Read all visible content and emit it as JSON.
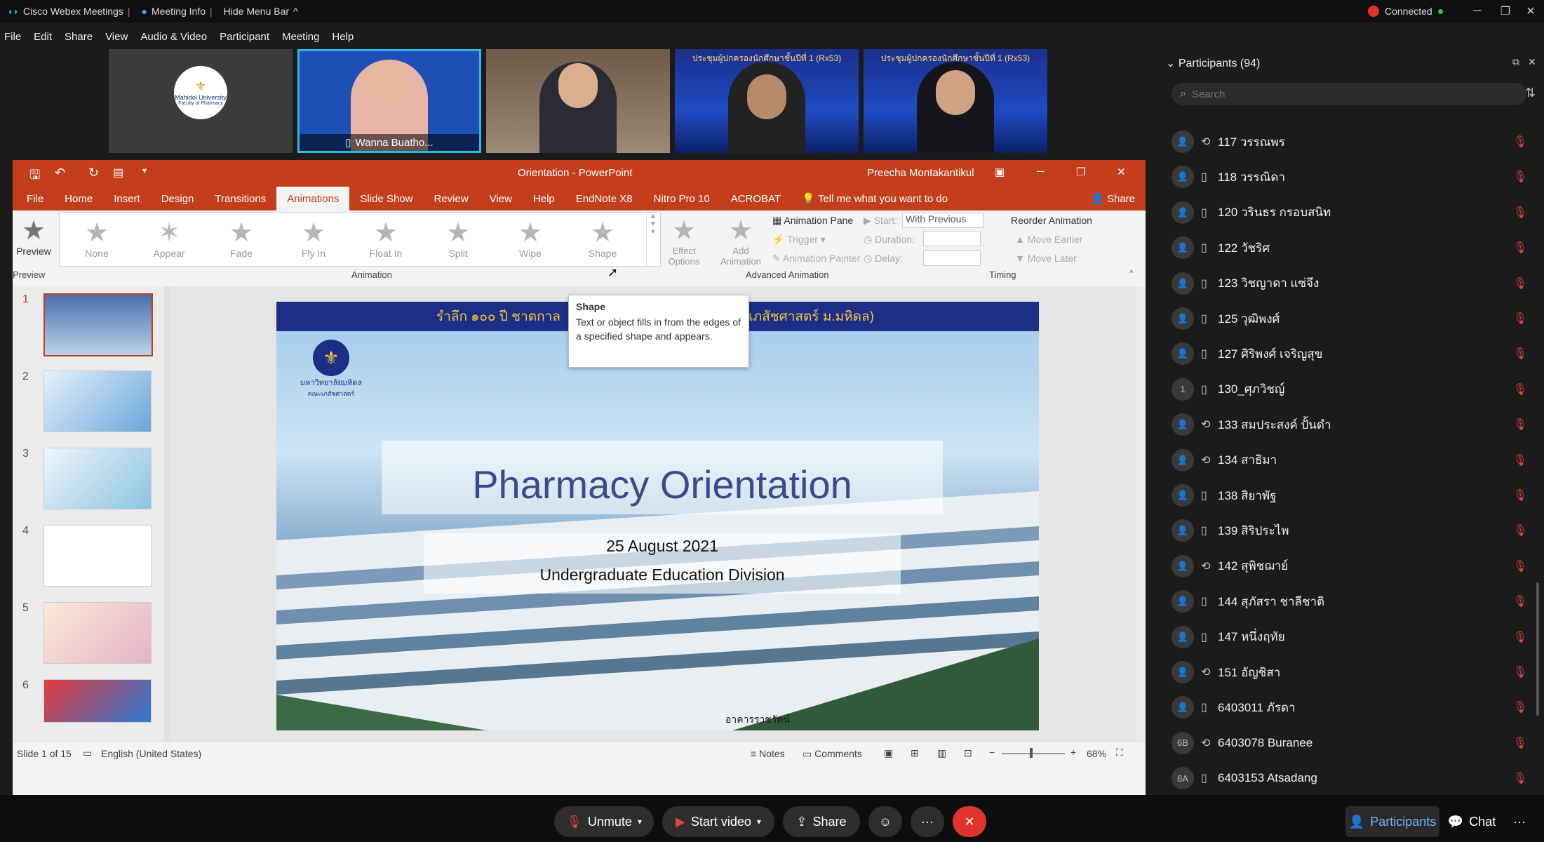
{
  "webex": {
    "app_title": "Cisco Webex Meetings",
    "meeting_info": "Meeting Info",
    "hide_menu": "Hide Menu Bar",
    "connected": "Connected",
    "menu": [
      "File",
      "Edit",
      "Share",
      "View",
      "Audio & Video",
      "Participant",
      "Meeting",
      "Help"
    ]
  },
  "videos": [
    {
      "kind": "logo",
      "logo_text": "Mahidol University",
      "logo_sub": "Faculty of Pharmacy"
    },
    {
      "kind": "person",
      "name": "Wanna Buatho..."
    },
    {
      "kind": "person"
    },
    {
      "kind": "person",
      "banner": "ประชุมผู้ปกครองนักศึกษาชั้นปีที่ 1 (Rx53)"
    },
    {
      "kind": "person",
      "banner": "ประชุมผู้ปกครองนักศึกษาชั้นปีที่ 1 (Rx53)"
    }
  ],
  "ppt": {
    "title": "Orientation  -  PowerPoint",
    "user": "Preecha Montakantikul",
    "tabs": [
      "File",
      "Home",
      "Insert",
      "Design",
      "Transitions",
      "Animations",
      "Slide Show",
      "Review",
      "View",
      "Help",
      "EndNote X8",
      "Nitro Pro 10",
      "ACROBAT"
    ],
    "active_tab": "Animations",
    "tell_me": "Tell me what you want to do",
    "share": "Share",
    "preview": "Preview",
    "preview_group": "Preview",
    "animations": [
      "None",
      "Appear",
      "Fade",
      "Fly In",
      "Float In",
      "Split",
      "Wipe",
      "Shape"
    ],
    "animation_group": "Animation",
    "effect_options": "Effect Options",
    "add_animation": "Add Animation",
    "animation_pane": "Animation Pane",
    "trigger": "Trigger",
    "animation_painter": "Animation Painter",
    "advanced_group": "Advanced Animation",
    "start_label": "Start:",
    "start_value": "With Previous",
    "duration_label": "Duration:",
    "delay_label": "Delay:",
    "reorder": "Reorder Animation",
    "move_earlier": "Move Earlier",
    "move_later": "Move Later",
    "timing_group": "Timing",
    "tooltip_title": "Shape",
    "tooltip_body": "Text or object fills in from the edges of a specified shape and appears.",
    "thumbs": [
      "1",
      "2",
      "3",
      "4",
      "5",
      "6"
    ],
    "slide": {
      "banner": "รำลึก ๑๐๐ ปี ชาตกาล",
      "banner_right": "ะเภสัชศาสตร์ ม.มหิดล)",
      "logo_caption": "มหาวิทยาลัยมหิดล",
      "logo_sub": "คณะเภสัชศาสตร์",
      "title": "Pharmacy Orientation",
      "date": "25 August 2021",
      "division": "Undergraduate Education Division",
      "building_sign": "อาคารราชรัตน์"
    },
    "status": {
      "slide_of": "Slide 1 of 15",
      "language": "English (United States)",
      "notes": "Notes",
      "comments": "Comments",
      "zoom": "68%"
    }
  },
  "participants": {
    "title": "Participants (94)",
    "search_placeholder": "Search",
    "list": [
      {
        "avatar": "",
        "device": "sync",
        "name": "117 วรรณพร"
      },
      {
        "avatar": "",
        "device": "phone",
        "name": "118 วรรณิดา"
      },
      {
        "avatar": "",
        "device": "phone",
        "name": "120 วรินธร กรอบสนิท"
      },
      {
        "avatar": "",
        "device": "phone",
        "name": "122 วัชริศ"
      },
      {
        "avatar": "",
        "device": "phone",
        "name": "123 วิชญาดา แซ่จึง"
      },
      {
        "avatar": "",
        "device": "phone",
        "name": "125 วุฒิพงศ์"
      },
      {
        "avatar": "",
        "device": "phone",
        "name": "127 ศิริพงศ์ เจริญสุข"
      },
      {
        "avatar": "1",
        "device": "phone",
        "name": "130_ศุภวิชญ์"
      },
      {
        "avatar": "",
        "device": "sync",
        "name": "133 สมประสงค์ ปั้นดำ"
      },
      {
        "avatar": "",
        "device": "sync",
        "name": "134 สาธิมา"
      },
      {
        "avatar": "",
        "device": "phone",
        "name": "138 สิยาพัฐ"
      },
      {
        "avatar": "",
        "device": "phone",
        "name": "139 สิริประไพ"
      },
      {
        "avatar": "",
        "device": "sync",
        "name": "142 สุพิชฌาย์"
      },
      {
        "avatar": "",
        "device": "phone",
        "name": "144 สุภัสรา ชาลีชาติ"
      },
      {
        "avatar": "",
        "device": "phone",
        "name": "147 หนึ่งฤทัย"
      },
      {
        "avatar": "",
        "device": "sync",
        "name": "151 อัญชิสา"
      },
      {
        "avatar": "",
        "device": "phone",
        "name": "6403011 ภัรดา"
      },
      {
        "avatar": "6B",
        "device": "sync",
        "name": "6403078 Buranee"
      },
      {
        "avatar": "6A",
        "device": "phone",
        "name": "6403153 Atsadang"
      }
    ]
  },
  "bottom": {
    "unmute": "Unmute",
    "start_video": "Start video",
    "share": "Share",
    "more": "···",
    "participants": "Participants",
    "chat": "Chat"
  },
  "colors": {
    "ppt_red": "#c43e1c",
    "leave_red": "#e0332b",
    "connected_green": "#3fbf3f",
    "highlight_cyan": "#2bb7e8"
  }
}
